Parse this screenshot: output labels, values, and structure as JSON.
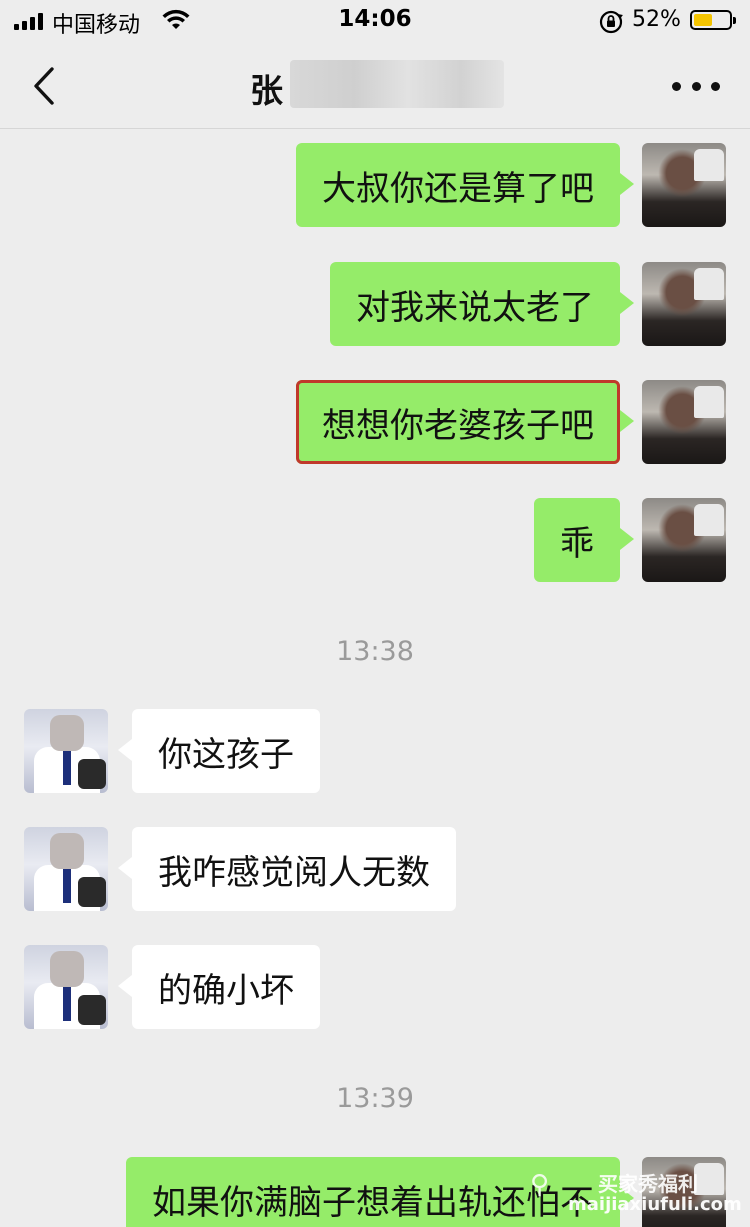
{
  "status_bar": {
    "carrier": "中国移动",
    "time": "14:06",
    "battery": "52%",
    "battery_level": 0.52,
    "battery_color": "#f4c400"
  },
  "nav": {
    "back_icon": "chevron-left-icon",
    "title": "张",
    "more_icon": "more-dots-icon"
  },
  "colors": {
    "background": "#ededed",
    "outgoing_bubble": "#95ec69",
    "incoming_bubble": "#ffffff",
    "highlight_border": "#c0392b"
  },
  "messages": [
    {
      "side": "out",
      "text": "大叔你还是算了吧"
    },
    {
      "side": "out",
      "text": "对我来说太老了"
    },
    {
      "side": "out",
      "text": "想想你老婆孩子吧",
      "highlighted": true
    },
    {
      "side": "out",
      "text": "乖"
    },
    {
      "type": "time",
      "text": "13:38"
    },
    {
      "side": "in",
      "text": "你这孩子"
    },
    {
      "side": "in",
      "text": "我咋感觉阅人无数"
    },
    {
      "side": "in",
      "text": "的确小坏"
    },
    {
      "type": "time",
      "text": "13:39"
    },
    {
      "side": "out",
      "text": "如果你满脑子想着出轨还怕不"
    }
  ],
  "watermark": {
    "text_cn": "买家秀福利",
    "url": "maijiaxiufuli.com"
  }
}
